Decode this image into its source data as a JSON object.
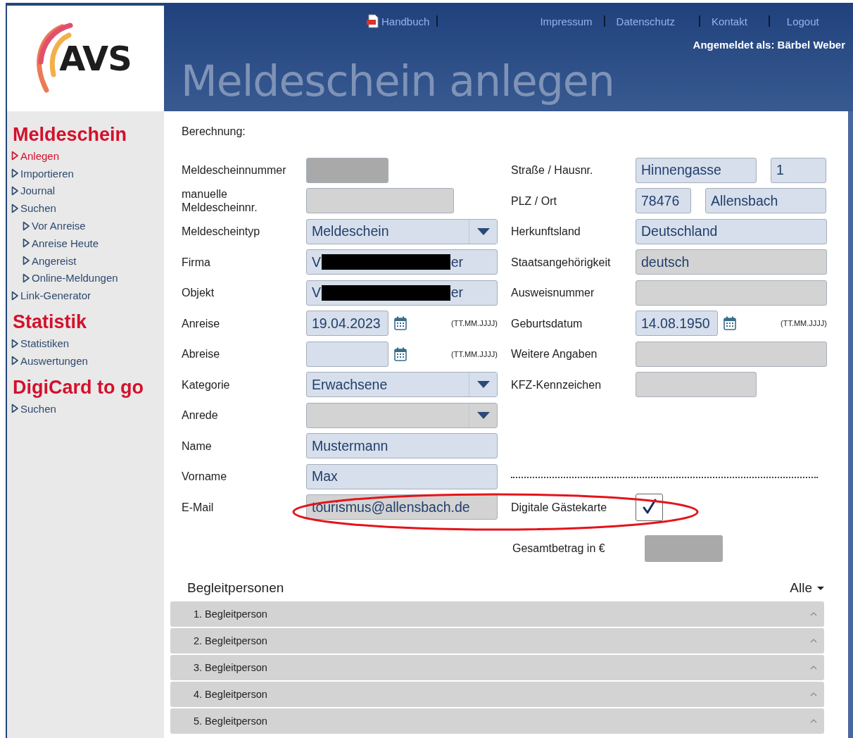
{
  "logo": {
    "text": "AVS"
  },
  "header": {
    "manual_link": "Handbuch",
    "links": [
      "Impressum",
      "Datenschutz",
      "Kontakt",
      "Logout"
    ],
    "user": "Angemeldet als: Bärbel Weber",
    "title": "Meldeschein anlegen"
  },
  "sidebar": {
    "sections": [
      {
        "title": "Meldeschein",
        "items": [
          {
            "label": "Anlegen",
            "selected": true
          },
          {
            "label": "Importieren",
            "selected": false
          },
          {
            "label": "Journal",
            "selected": false
          },
          {
            "label": "Suchen",
            "selected": false,
            "children": [
              {
                "label": "Vor Anreise",
                "selected": false
              },
              {
                "label": "Anreise Heute",
                "selected": false
              },
              {
                "label": "Angereist",
                "selected": false
              },
              {
                "label": "Online-Meldungen",
                "selected": false
              }
            ]
          },
          {
            "label": "Link-Generator",
            "selected": false
          }
        ]
      },
      {
        "title": "Statistik",
        "items": [
          {
            "label": "Statistiken",
            "selected": false
          },
          {
            "label": "Auswertungen",
            "selected": false
          }
        ]
      },
      {
        "title": "DigiCard to go",
        "items": [
          {
            "label": "Suchen",
            "selected": false
          }
        ]
      }
    ]
  },
  "form": {
    "heading": "Berechnung:",
    "left": [
      {
        "kind": "text",
        "label": "Meldescheinnummer",
        "fields": [
          {
            "disabled": true,
            "locked": true
          }
        ]
      },
      {
        "kind": "text",
        "label": "manuelle\nMeldescheinnr.",
        "fields": [
          {
            "disabled": true,
            "locked": false
          }
        ]
      },
      {
        "kind": "select",
        "label": "Meldescheintyp",
        "fields": [
          {
            "disabled": false,
            "locked": false,
            "value": "Meldeschein"
          }
        ]
      },
      {
        "kind": "text",
        "label": "Firma",
        "fields": [
          {
            "disabled": false,
            "locked": false,
            "value_parts": [
              "V",
              "er"
            ],
            "redacted": true
          }
        ]
      },
      {
        "kind": "text",
        "label": "Objekt",
        "fields": [
          {
            "disabled": false,
            "locked": false,
            "value_parts": [
              "V",
              "er"
            ],
            "redacted": true
          }
        ]
      },
      {
        "kind": "date",
        "label": "Anreise",
        "fields": [
          {
            "disabled": false,
            "locked": false,
            "value": "19.04.2023"
          }
        ],
        "hint": "(TT.MM.JJJJ)"
      },
      {
        "kind": "date",
        "label": "Abreise",
        "fields": [
          {
            "disabled": false,
            "locked": false
          }
        ],
        "hint": "(TT.MM.JJJJ)"
      },
      {
        "kind": "select",
        "label": "Kategorie",
        "fields": [
          {
            "disabled": false,
            "locked": false,
            "value": "Erwachsene"
          }
        ]
      },
      {
        "kind": "select",
        "label": "Anrede",
        "fields": [
          {
            "disabled": true,
            "locked": false
          }
        ]
      },
      {
        "kind": "text",
        "label": "Name",
        "fields": [
          {
            "disabled": false,
            "locked": false,
            "value": "Mustermann"
          }
        ]
      },
      {
        "kind": "text",
        "label": "Vorname",
        "fields": [
          {
            "disabled": false,
            "locked": false,
            "value": "Max"
          }
        ]
      },
      {
        "kind": "text",
        "label": "E-Mail",
        "fields": [
          {
            "disabled": true,
            "locked": false,
            "value": "tourismus@allensbach.de"
          }
        ]
      }
    ],
    "right": [
      {
        "kind": "text",
        "label": "Straße / Hausnr.",
        "fields": [
          {
            "disabled": false,
            "locked": false,
            "value": "Hinnengasse"
          },
          {
            "disabled": false,
            "locked": false,
            "value": "1"
          }
        ]
      },
      {
        "kind": "text",
        "label": "PLZ / Ort",
        "fields": [
          {
            "disabled": false,
            "locked": false,
            "value": "78476"
          },
          {
            "disabled": false,
            "locked": false,
            "value": "Allensbach"
          }
        ]
      },
      {
        "kind": "text",
        "label": "Herkunftsland",
        "fields": [
          {
            "disabled": false,
            "locked": false,
            "value": "Deutschland"
          }
        ]
      },
      {
        "kind": "text",
        "label": "Staatsangehörigkeit",
        "fields": [
          {
            "disabled": true,
            "locked": false,
            "value": "deutsch"
          }
        ]
      },
      {
        "kind": "text",
        "label": "Ausweisnummer",
        "fields": [
          {
            "disabled": true,
            "locked": false
          }
        ]
      },
      {
        "kind": "date",
        "label": "Geburtsdatum",
        "fields": [
          {
            "disabled": false,
            "locked": false,
            "value": "14.08.1950"
          }
        ],
        "hint": "(TT.MM.JJJJ)"
      },
      {
        "kind": "text",
        "label": "Weitere Angaben",
        "fields": [
          {
            "disabled": true,
            "locked": false
          }
        ]
      },
      {
        "kind": "text",
        "label": "KFZ-Kennzeichen",
        "fields": [
          {
            "disabled": true,
            "locked": false
          }
        ]
      },
      {
        "kind": "blank"
      },
      {
        "kind": "blank"
      },
      {
        "kind": "separator"
      },
      {
        "kind": "checkbox",
        "label": "Digitale Gästekarte",
        "checked": true
      }
    ],
    "highlight": {
      "color": "#e3141c"
    },
    "total": {
      "label": "Gesamtbetrag in €",
      "disabled": true,
      "locked": true
    }
  },
  "companions": {
    "title": "Begleitpersonen",
    "filter": "Alle",
    "items": [
      {
        "label": "1. Begleitperson"
      },
      {
        "label": "2. Begleitperson"
      },
      {
        "label": "3. Begleitperson"
      },
      {
        "label": "4. Begleitperson"
      },
      {
        "label": "5. Begleitperson"
      }
    ]
  }
}
